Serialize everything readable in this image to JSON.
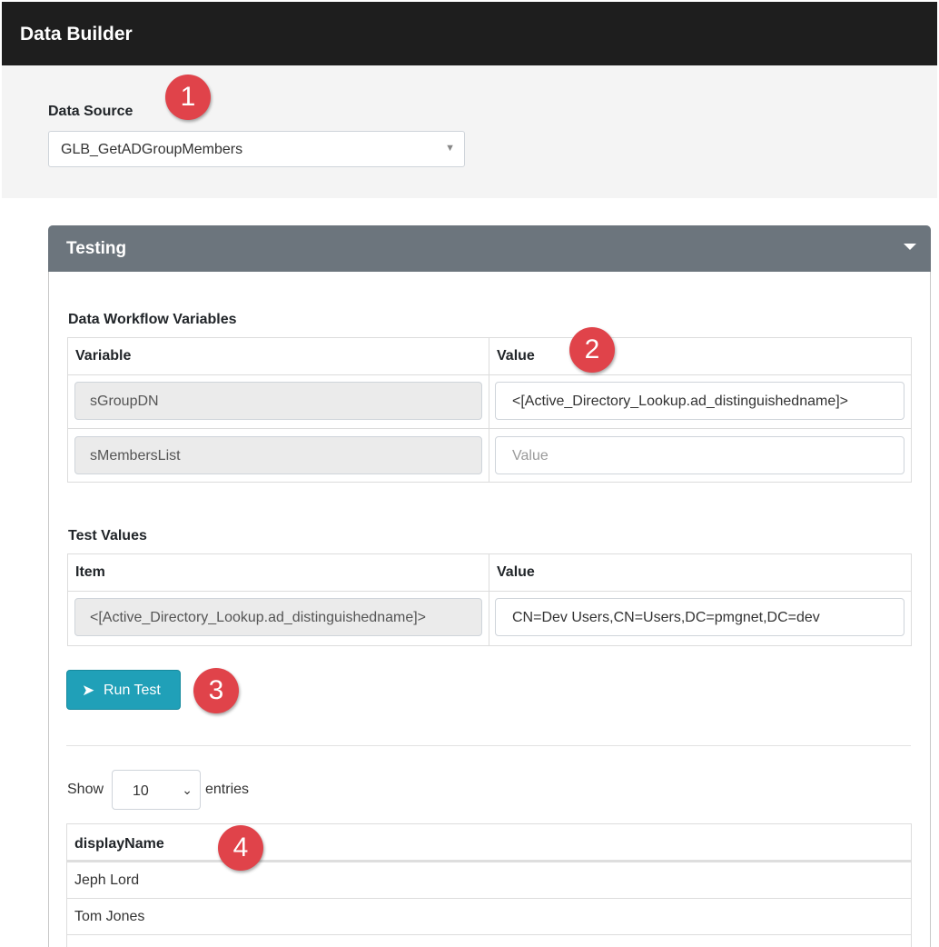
{
  "app": {
    "title": "Data Builder"
  },
  "data_source": {
    "label": "Data Source",
    "selected": "GLB_GetADGroupMembers",
    "badge": "1"
  },
  "testing": {
    "header": "Testing",
    "variables": {
      "title": "Data Workflow Variables",
      "col_variable": "Variable",
      "col_value": "Value",
      "badge": "2",
      "rows": [
        {
          "name": "sGroupDN",
          "value": "<[Active_Directory_Lookup.ad_distinguishedname]>",
          "placeholder": ""
        },
        {
          "name": "sMembersList",
          "value": "",
          "placeholder": "Value"
        }
      ]
    },
    "test_values": {
      "title": "Test Values",
      "col_item": "Item",
      "col_value": "Value",
      "rows": [
        {
          "item": "<[Active_Directory_Lookup.ad_distinguishedname]>",
          "value": "CN=Dev Users,CN=Users,DC=pmgnet,DC=dev"
        }
      ]
    },
    "run_button": {
      "label": "Run Test",
      "icon": "paper-plane-icon",
      "badge": "3"
    },
    "results": {
      "show_label": "Show",
      "page_length": "10",
      "entries_label": "entries",
      "column": "displayName",
      "badge": "4",
      "rows": [
        "Jeph Lord",
        "Tom Jones"
      ]
    }
  }
}
